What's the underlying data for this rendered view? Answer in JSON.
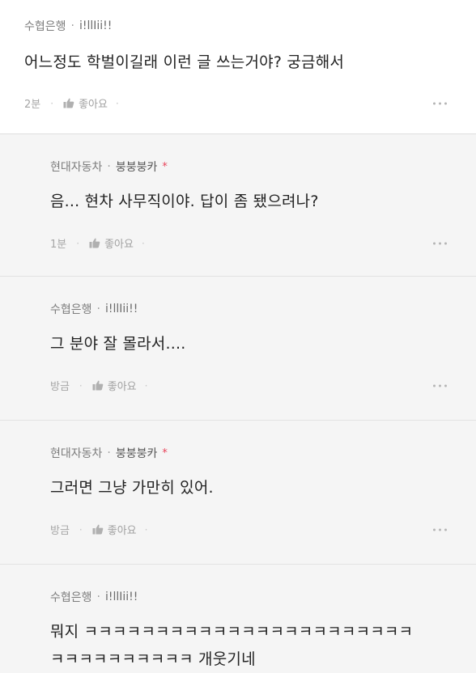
{
  "comments": [
    {
      "company": "수협은행",
      "nickname": "i!llIii!!",
      "text": "어느정도 학벌이길래 이런 글 쓰는거야? 궁금해서",
      "time": "2분",
      "like_label": "좋아요"
    },
    {
      "company": "현대자동차",
      "nickname": "붕붕붕카",
      "author_mark": "*",
      "text": "음... 현차 사무직이야. 답이 좀 됐으려나?",
      "time": "1분",
      "like_label": "좋아요"
    },
    {
      "company": "수협은행",
      "nickname": "i!llIii!!",
      "text": "그 분야 잘 몰라서....",
      "time": "방금",
      "like_label": "좋아요"
    },
    {
      "company": "현대자동차",
      "nickname": "붕붕붕카",
      "author_mark": "*",
      "text": "그러면 그냥 가만히 있어.",
      "time": "방금",
      "like_label": "좋아요"
    },
    {
      "company": "수협은행",
      "nickname": "i!llIii!!",
      "text_line1": "뭐지 ㅋㅋㅋㅋㅋㅋㅋㅋㅋㅋㅋㅋㅋㅋㅋㅋㅋㅋㅋㅋㅋㅋㅋ",
      "text_line2": "ㅋㅋㅋㅋㅋㅋㅋㅋㅋㅋ 개웃기네"
    }
  ],
  "separator": "·",
  "icons": {
    "like": "thumbs-up-icon",
    "more": "more-dots-icon"
  },
  "colors": {
    "author_mark": "#e8455b",
    "reply_bg": "#f5f5f5",
    "top_bg": "#ffffff"
  }
}
